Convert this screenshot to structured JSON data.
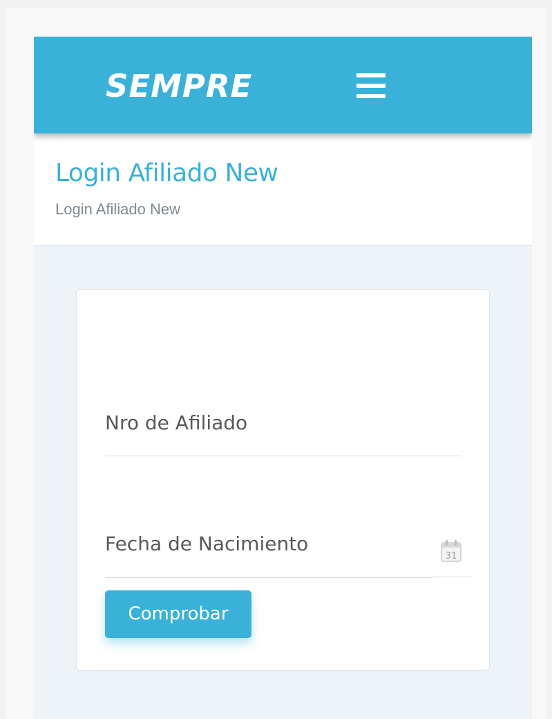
{
  "brand": {
    "logo_text": "SEMPRE",
    "color": "#3ab1d9"
  },
  "topbar": {
    "menu_icon": "hamburger-menu-icon"
  },
  "header": {
    "title": "Login Afiliado New",
    "breadcrumb": "Login Afiliado New"
  },
  "form": {
    "afiliado_placeholder": "Nro de Afiliado",
    "afiliado_value": "",
    "fecha_placeholder": "Fecha de Nacimiento",
    "fecha_value": "",
    "calendar_icon": "calendar-icon",
    "calendar_day": "31",
    "submit_label": "Comprobar"
  }
}
